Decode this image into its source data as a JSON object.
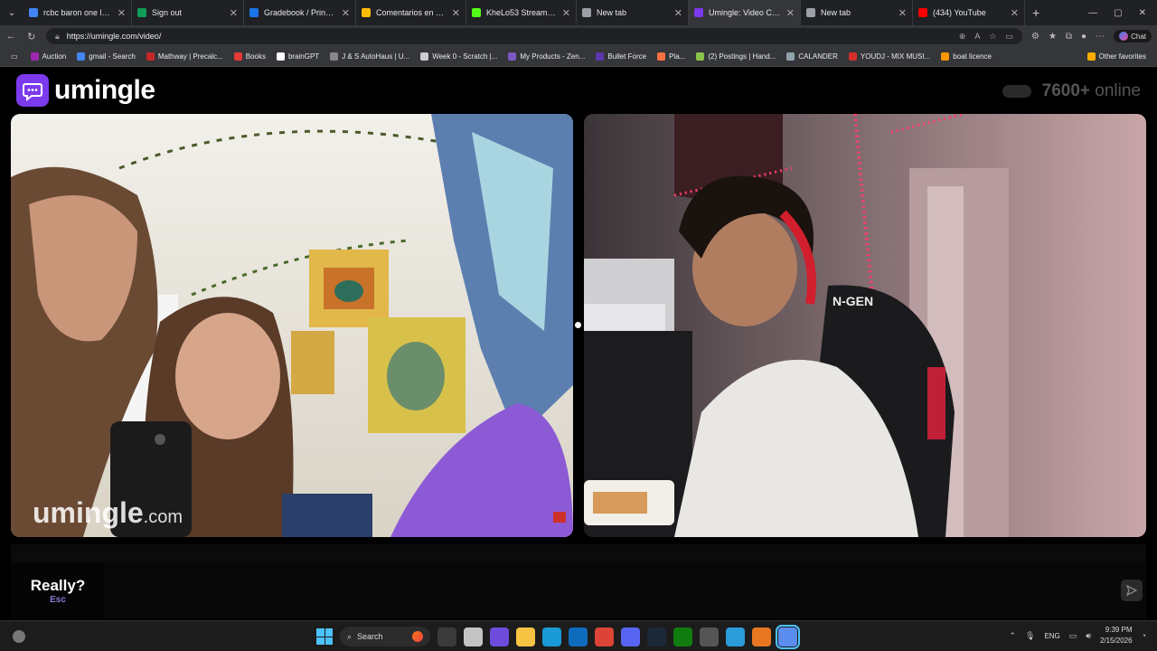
{
  "browser": {
    "tabs": [
      {
        "title": "rcbc baron one login",
        "color": "#4285f4"
      },
      {
        "title": "Sign out",
        "color": "#0f9d58"
      },
      {
        "title": "Gradebook / Principles",
        "color": "#1a73e8"
      },
      {
        "title": "Comentarios en español",
        "color": "#fbbc05"
      },
      {
        "title": "KheLo53 Stream - Watch",
        "color": "#53fc18"
      },
      {
        "title": "New tab",
        "color": "#9aa0a6"
      },
      {
        "title": "Umingle: Video Chat",
        "color": "#7c3aed"
      },
      {
        "title": "New tab",
        "color": "#9aa0a6"
      },
      {
        "title": "(434) YouTube",
        "color": "#ff0000"
      }
    ],
    "url": "https://umingle.com/video/",
    "chat_label": "Chat",
    "bookmarks": [
      {
        "label": "Auction",
        "color": "#9c27b0"
      },
      {
        "label": "gmail - Search",
        "color": "#4285f4"
      },
      {
        "label": "Mathway | Precalc...",
        "color": "#c62828"
      },
      {
        "label": "Books",
        "color": "#e53935"
      },
      {
        "label": "brainGPT",
        "color": "#ffffff"
      },
      {
        "label": "J & S AutoHaus | U...",
        "color": "#888888"
      },
      {
        "label": "Week 0 - Scratch |...",
        "color": "#cccccc"
      },
      {
        "label": "My Products - Zen...",
        "color": "#7e57c2"
      },
      {
        "label": "Bullet Force",
        "color": "#5e35b1"
      },
      {
        "label": "Pla...",
        "color": "#ff7043"
      },
      {
        "label": "(2) Postings | Hand...",
        "color": "#8bc34a"
      },
      {
        "label": "CALANDER",
        "color": "#90a4ae"
      },
      {
        "label": "YOUDJ - MIX MUSI...",
        "color": "#d32f2f"
      },
      {
        "label": "boat licence",
        "color": "#ff9800"
      }
    ],
    "other_favorites": "Other favorites"
  },
  "site": {
    "logo_text": "umingle",
    "online_count": "7600+",
    "online_label": "online",
    "watermark_name": "umingle",
    "watermark_suffix": ".com"
  },
  "chat": {
    "skip_label": "Really?",
    "skip_hint": "Esc",
    "input_value": ""
  },
  "taskbar": {
    "search_label": "Search",
    "language": "ENG",
    "time": "9:39 PM",
    "date": "2/15/2026"
  }
}
